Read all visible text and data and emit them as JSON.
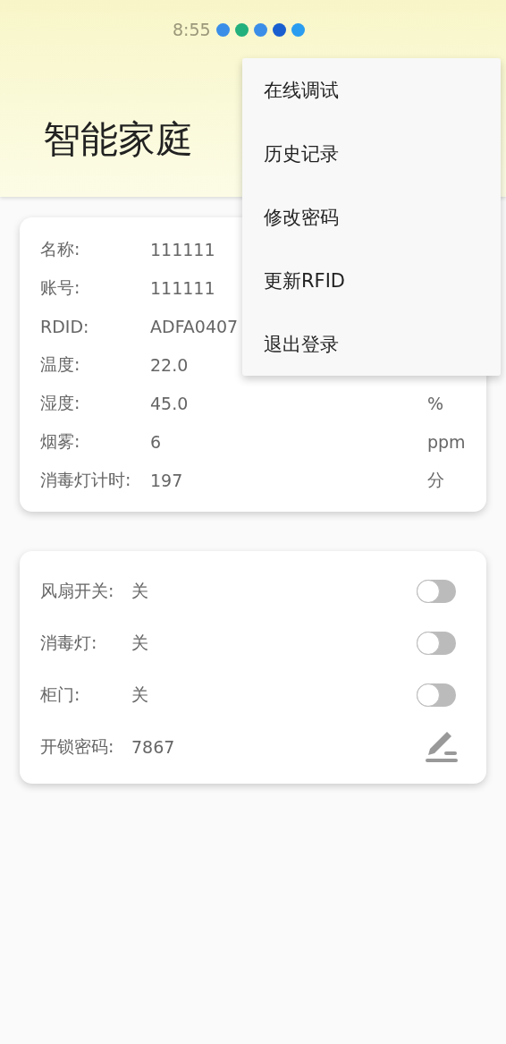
{
  "status_bar": {
    "time": "8:55"
  },
  "header": {
    "title": "智能家庭"
  },
  "sensor_card": {
    "rows": [
      {
        "label": "名称:",
        "value": "111111"
      },
      {
        "label": "账号:",
        "value": "111111"
      },
      {
        "label": "RDID:",
        "value": "ADFA0407"
      },
      {
        "label": "温度:",
        "value": "22.0"
      },
      {
        "label": "湿度:",
        "value": "45.0",
        "unit": "%"
      },
      {
        "label": "烟雾:",
        "value": "6",
        "unit": "ppm"
      },
      {
        "label": "消毒灯计时:",
        "value": "197",
        "unit": "分"
      }
    ]
  },
  "control_card": {
    "rows": [
      {
        "kind": "switch",
        "label": "风扇开关:",
        "value": "关",
        "on": false
      },
      {
        "kind": "switch",
        "label": "消毒灯:",
        "value": "关",
        "on": false
      },
      {
        "kind": "switch",
        "label": "柜门:",
        "value": "关",
        "on": false
      },
      {
        "kind": "edit",
        "label": "开锁密码:",
        "value": "7867"
      }
    ]
  },
  "menu": {
    "items": [
      "在线调试",
      "历史记录",
      "修改密码",
      "更新RFID",
      "退出登录"
    ]
  }
}
